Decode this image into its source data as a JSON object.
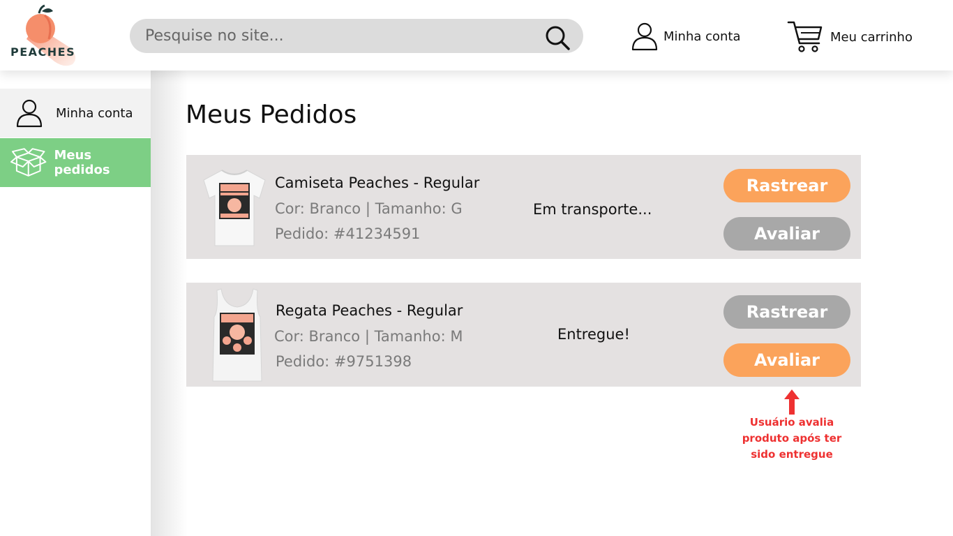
{
  "brand": {
    "name": "PEACHES",
    "accent": "#fba35b",
    "logo_color": "#f39374"
  },
  "header": {
    "search": {
      "placeholder": "Pesquise no site...",
      "icon": "search-icon"
    },
    "account_label": "Minha conta",
    "cart_label": "Meu carrinho"
  },
  "sidebar": {
    "items": [
      {
        "label": "Minha conta",
        "icon": "user-icon",
        "active": false
      },
      {
        "label": "Meus pedidos",
        "icon": "box-icon",
        "active": true,
        "color": "#7dcf85"
      }
    ]
  },
  "main": {
    "title": "Meus Pedidos",
    "orders": [
      {
        "name": "Camiseta Peaches - Regular",
        "attributes": "Cor: Branco | Tamanho: G",
        "order_number": "Pedido: #41234591",
        "status": "Em transporte...",
        "track_label": "Rastrear",
        "rate_label": "Avaliar",
        "image": "tshirt-image"
      },
      {
        "name": "Regata Peaches - Regular",
        "attributes": "Cor: Branco | Tamanho: M",
        "order_number": "Pedido: #9751398",
        "status": "Entregue!",
        "track_label": "Rastrear",
        "rate_label": "Avaliar",
        "image": "tanktop-image"
      }
    ]
  },
  "annotation": {
    "lines": [
      "Usuário avalia",
      "produto após ter",
      "sido entregue"
    ],
    "color": "#ee3131"
  }
}
